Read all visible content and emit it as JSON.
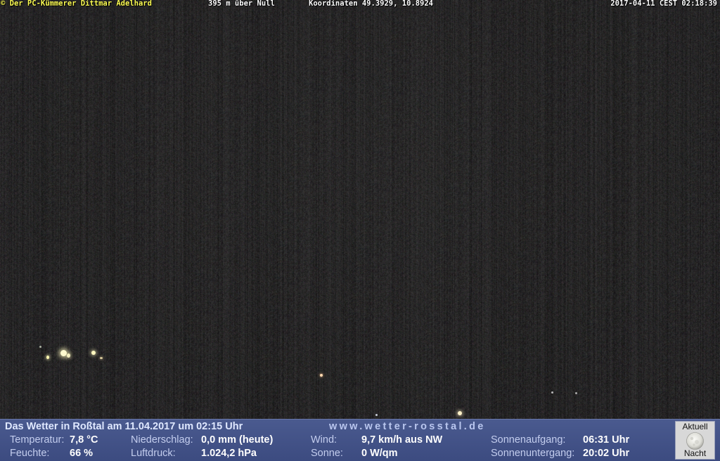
{
  "overlay": {
    "credit": "© Der PC-Kümmerer Dittmar Adelhard",
    "altitude": "395 m über Null",
    "coordinates": "Koordinaten 49.3929, 10.8924",
    "timestamp": "2017-04-11 CEST 02:18:39"
  },
  "weather": {
    "title": "Das Wetter in Roßtal am 11.04.2017 um 02:15 Uhr",
    "website": "www.wetter-rosstal.de",
    "temperature_label": "Temperatur:",
    "temperature_value": "7,8 °C",
    "humidity_label": "Feuchte:",
    "humidity_value": "66 %",
    "precipitation_label": "Niederschlag:",
    "precipitation_value": "0,0 mm (heute)",
    "pressure_label": "Luftdruck:",
    "pressure_value": "1.024,2 hPa",
    "wind_label": "Wind:",
    "wind_value": "9,7 km/h aus NW",
    "sun_label": "Sonne:",
    "sun_value": "0 W/qm",
    "sunrise_label": "Sonnenaufgang:",
    "sunrise_value": "06:31 Uhr",
    "sunset_label": "Sonnenuntergang:",
    "sunset_value": "20:02 Uhr"
  },
  "moon": {
    "top_label": "Aktuell",
    "bottom_label": "Nacht",
    "icon": "full-moon-icon"
  },
  "colors": {
    "credit": "#ffff55",
    "weather_bar": "#4a5a8f",
    "label": "#c3cdee",
    "value": "#ffffff"
  }
}
